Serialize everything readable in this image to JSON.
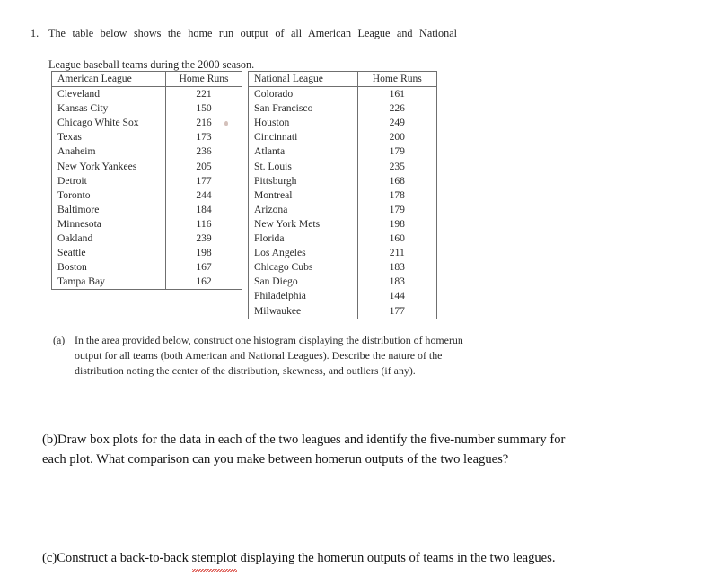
{
  "question": {
    "number": "1.",
    "line1": "The table below shows the home run output of all American League and National",
    "line2": "League baseball teams during the 2000 season."
  },
  "tables": {
    "american": {
      "name": "American League table",
      "headers": [
        "American League",
        "Home Runs"
      ],
      "rows": [
        [
          "Cleveland",
          "221"
        ],
        [
          "Kansas City",
          "150"
        ],
        [
          "Chicago White Sox",
          "216"
        ],
        [
          "Texas",
          "173"
        ],
        [
          "Anaheim",
          "236"
        ],
        [
          "New York Yankees",
          "205"
        ],
        [
          "Detroit",
          "177"
        ],
        [
          "Toronto",
          "244"
        ],
        [
          "Baltimore",
          "184"
        ],
        [
          "Minnesota",
          "116"
        ],
        [
          "Oakland",
          "239"
        ],
        [
          "Seattle",
          "198"
        ],
        [
          "Boston",
          "167"
        ],
        [
          "Tampa Bay",
          "162"
        ]
      ]
    },
    "national": {
      "name": "National League table",
      "headers": [
        "National League",
        "Home Runs"
      ],
      "rows": [
        [
          "Colorado",
          "161"
        ],
        [
          "San Francisco",
          "226"
        ],
        [
          "Houston",
          "249"
        ],
        [
          "Cincinnati",
          "200"
        ],
        [
          "Atlanta",
          "179"
        ],
        [
          "St. Louis",
          "235"
        ],
        [
          "Pittsburgh",
          "168"
        ],
        [
          "Montreal",
          "178"
        ],
        [
          "Arizona",
          "179"
        ],
        [
          "New York Mets",
          "198"
        ],
        [
          "Florida",
          "160"
        ],
        [
          "Los Angeles",
          "211"
        ],
        [
          "Chicago Cubs",
          "183"
        ],
        [
          "San Diego",
          "183"
        ],
        [
          "Philadelphia",
          "144"
        ],
        [
          "Milwaukee",
          "177"
        ]
      ]
    }
  },
  "parts": {
    "a": {
      "label": "(a)",
      "text": "In the area provided below, construct one histogram displaying the distribution of homerun output for all teams (both American and National Leagues). Describe the nature of the distribution noting the center of the distribution, skewness, and outliers (if any)."
    },
    "b": {
      "label": "(b)",
      "text": "Draw box plots for the data in each of the two leagues and identify the five-number summary for each plot. What comparison can you make between homerun outputs of the two leagues?"
    },
    "c": {
      "label": "(c)",
      "text_before": "Construct a back-to-back ",
      "misspelled_word": "stemplot",
      "text_after": " displaying the homerun outputs of teams in the two leagues."
    }
  }
}
